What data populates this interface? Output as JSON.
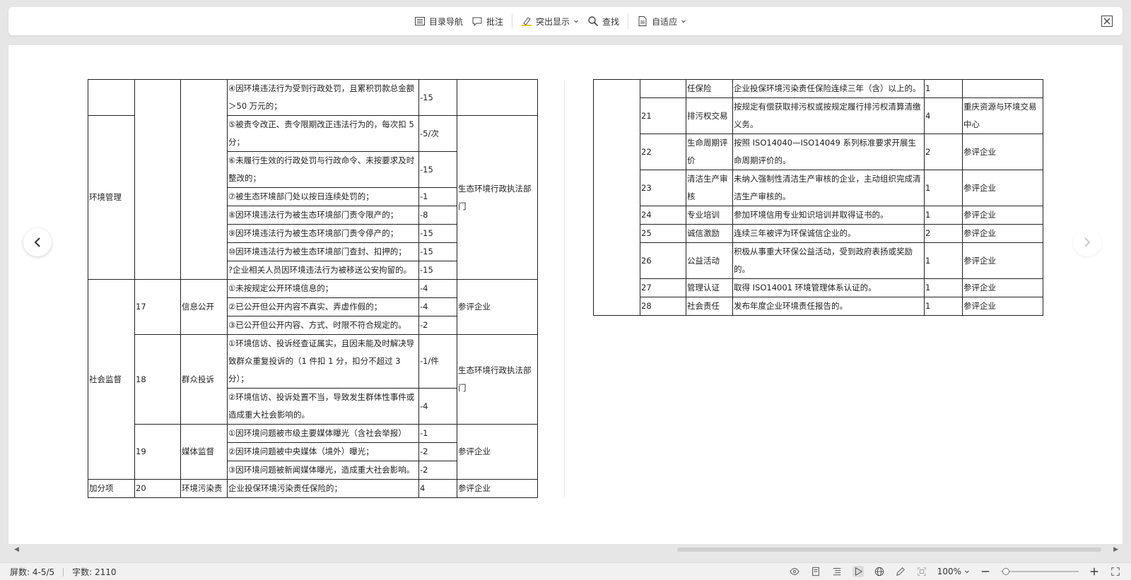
{
  "toolbar": {
    "toc_label": "目录导航",
    "comment_label": "批注",
    "highlight_label": "突出显示",
    "find_label": "查找",
    "fit_label": "自适应"
  },
  "left_table": [
    {
      "col1": "",
      "col2": "",
      "col3": "",
      "item": "④因环境违法行为受到行政处罚，且累积罚款总金额＞50 万元的；",
      "score": "-15",
      "org": ""
    },
    {
      "col1": "环境管理",
      "item": "⑤被责令改正、责令限期改正违法行为的，每次扣 5 分；",
      "score": "-5/次",
      "org": "生态环境行政执法部门"
    },
    {
      "item": "⑥未履行生效的行政处罚与行政命令、未按要求及时整改的；",
      "score": "-15"
    },
    {
      "item": "⑦被生态环境部门处以按日连续处罚的；",
      "score": "-1"
    },
    {
      "item": "⑧因环境违法行为被生态环境部门责令限产的；",
      "score": "-8"
    },
    {
      "item": "⑨因环境违法行为被生态环境部门责令停产的；",
      "score": "-15"
    },
    {
      "item": "⑩因环境违法行为被生态环境部门查封、扣押的；",
      "score": "-15"
    },
    {
      "item": "?企业相关人员因环境违法行为被移送公安拘留的。",
      "score": "-15"
    },
    {
      "col1": "社会监督",
      "col2": "17",
      "col3": "信息公开",
      "item": "①未按规定公开环境信息的；",
      "score": "-4",
      "org": "参评企业"
    },
    {
      "item": "②已公开但公开内容不真实、弄虚作假的；",
      "score": "-4"
    },
    {
      "item": "③已公开但公开内容、方式、时限不符合规定的。",
      "score": "-2"
    },
    {
      "col2": "18",
      "col3": "群众投诉",
      "item": "①环境信访、投诉经查证属实，且因未能及时解决导致群众重复投诉的（1 件扣 1 分，扣分不超过 3 分）；",
      "score": "-1/件",
      "org": "生态环境行政执法部门"
    },
    {
      "item": "②环境信访、投诉处置不当，导致发生群体性事件或造成重大社会影响的。",
      "score": "-4"
    },
    {
      "col2": "19",
      "col3": "媒体监督",
      "item": "①因环境问题被市级主要媒体曝光（含社会举报）",
      "score": "-1",
      "org": "参评企业"
    },
    {
      "item": "②因环境问题被中央媒体（境外）曝光；",
      "score": "-2"
    },
    {
      "item": "③因环境问题被新闻媒体曝光，造成重大社会影响。",
      "score": "-2"
    },
    {
      "col1": "加分项",
      "col2": "20",
      "col3": "环境污染责",
      "item": "企业投保环境污染责任保险的；",
      "score": "4",
      "org": "参评企业"
    }
  ],
  "right_table": [
    {
      "col1": "",
      "col2": "",
      "col3": "任保险",
      "item": "企业投保环境污染责任保险连续三年（含）以上的。",
      "score": "1",
      "org": ""
    },
    {
      "col2": "21",
      "col3": "排污权交易",
      "item": "按规定有偿获取排污权或按规定履行排污权清算清缴义务。",
      "score": "4",
      "org": "重庆资源与环境交易中心"
    },
    {
      "col2": "22",
      "col3": "生命周期评价",
      "item": "按照 ISO14040—ISO14049 系列标准要求开展生命周期评价的。",
      "score": "2",
      "org": "参评企业"
    },
    {
      "col2": "23",
      "col3": "清洁生产审核",
      "item": "未纳入强制性清洁生产审核的企业，主动组织完成清洁生产审核的。",
      "score": "1",
      "org": "参评企业"
    },
    {
      "col2": "24",
      "col3": "专业培训",
      "item": "参加环境信用专业知识培训并取得证书的。",
      "score": "1",
      "org": "参评企业"
    },
    {
      "col2": "25",
      "col3": "诚信激励",
      "item": "连续三年被评为环保诚信企业的。",
      "score": "2",
      "org": "参评企业"
    },
    {
      "col2": "26",
      "col3": "公益活动",
      "item": "积极从事重大环保公益活动，受到政府表扬或奖励的。",
      "score": "1",
      "org": "参评企业"
    },
    {
      "col2": "27",
      "col3": "管理认证",
      "item": "取得 ISO14001 环境管理体系认证的。",
      "score": "1",
      "org": "参评企业"
    },
    {
      "col2": "28",
      "col3": "社会责任",
      "item": "发布年度企业环境责任报告的。",
      "score": "1",
      "org": "参评企业"
    }
  ],
  "status": {
    "screens": "屏数: 4-5/5",
    "words": "字数: 2110",
    "zoom": "100%"
  }
}
